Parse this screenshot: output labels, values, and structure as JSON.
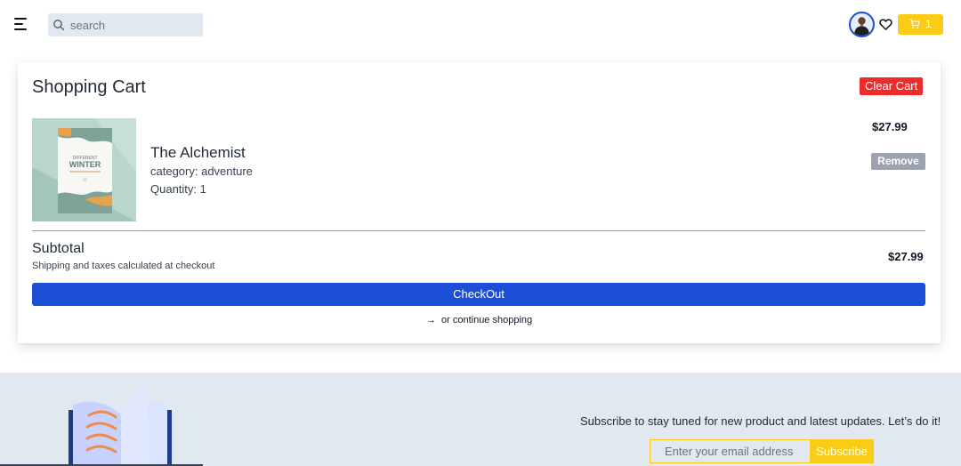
{
  "header": {
    "search_placeholder": "search",
    "cart_count": "1",
    "icons": [
      "menu-icon",
      "search-icon",
      "avatar",
      "heart-icon",
      "cart-icon"
    ]
  },
  "cart": {
    "title": "Shopping Cart",
    "clear_label": "Clear Cart",
    "items": [
      {
        "title": "The Alchemist",
        "category": "category: adventure",
        "quantity": "Quantity: 1",
        "price": "$27.99",
        "remove_label": "Remove",
        "cover_title_line1": "DIFFERENT",
        "cover_title_line2": "WINTER"
      }
    ],
    "subtotal_label": "Subtotal",
    "subtotal_note": "Shipping and taxes calculated at checkout",
    "subtotal_value": "$27.99",
    "checkout_label": "CheckOut",
    "continue_label": "or continue shopping"
  },
  "footer": {
    "subscribe_text": "Subscribe to stay tuned for new product and latest updates. Let’s do it!",
    "email_placeholder": "Enter your email address",
    "subscribe_label": "Subscribe"
  },
  "colors": {
    "accent_blue": "#1d4ed8",
    "clear_red": "#ef2b2b",
    "cart_yellow": "#facc15",
    "footer_bg": "#e2e8f0",
    "remove_gray": "#9ca3af"
  }
}
